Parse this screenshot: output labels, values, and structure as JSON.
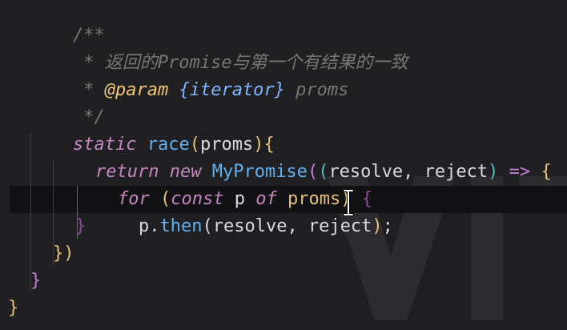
{
  "editor": {
    "lines": [
      {
        "id": "l1",
        "text": "/**"
      },
      {
        "id": "l2",
        "text": " * 返回的Promise与第一个有结果的一致"
      },
      {
        "id": "l3",
        "prefix": " * ",
        "tag": "@param",
        "type": "{iterator}",
        "name": " proms"
      },
      {
        "id": "l4",
        "text": " */"
      }
    ],
    "code": {
      "static": "static",
      "race": "race",
      "proms_param": "proms",
      "return": "return",
      "new": "new",
      "class_name": "MyPromise",
      "resolve": "resolve",
      "reject": "reject",
      "arrow": "=>",
      "for": "for",
      "const": "const",
      "p": "p",
      "of": "of",
      "proms": "proms",
      "then_obj": "p",
      "then": "then",
      "then_args_1": "resolve",
      "then_args_2": "reject",
      "semicolon": ";"
    }
  }
}
